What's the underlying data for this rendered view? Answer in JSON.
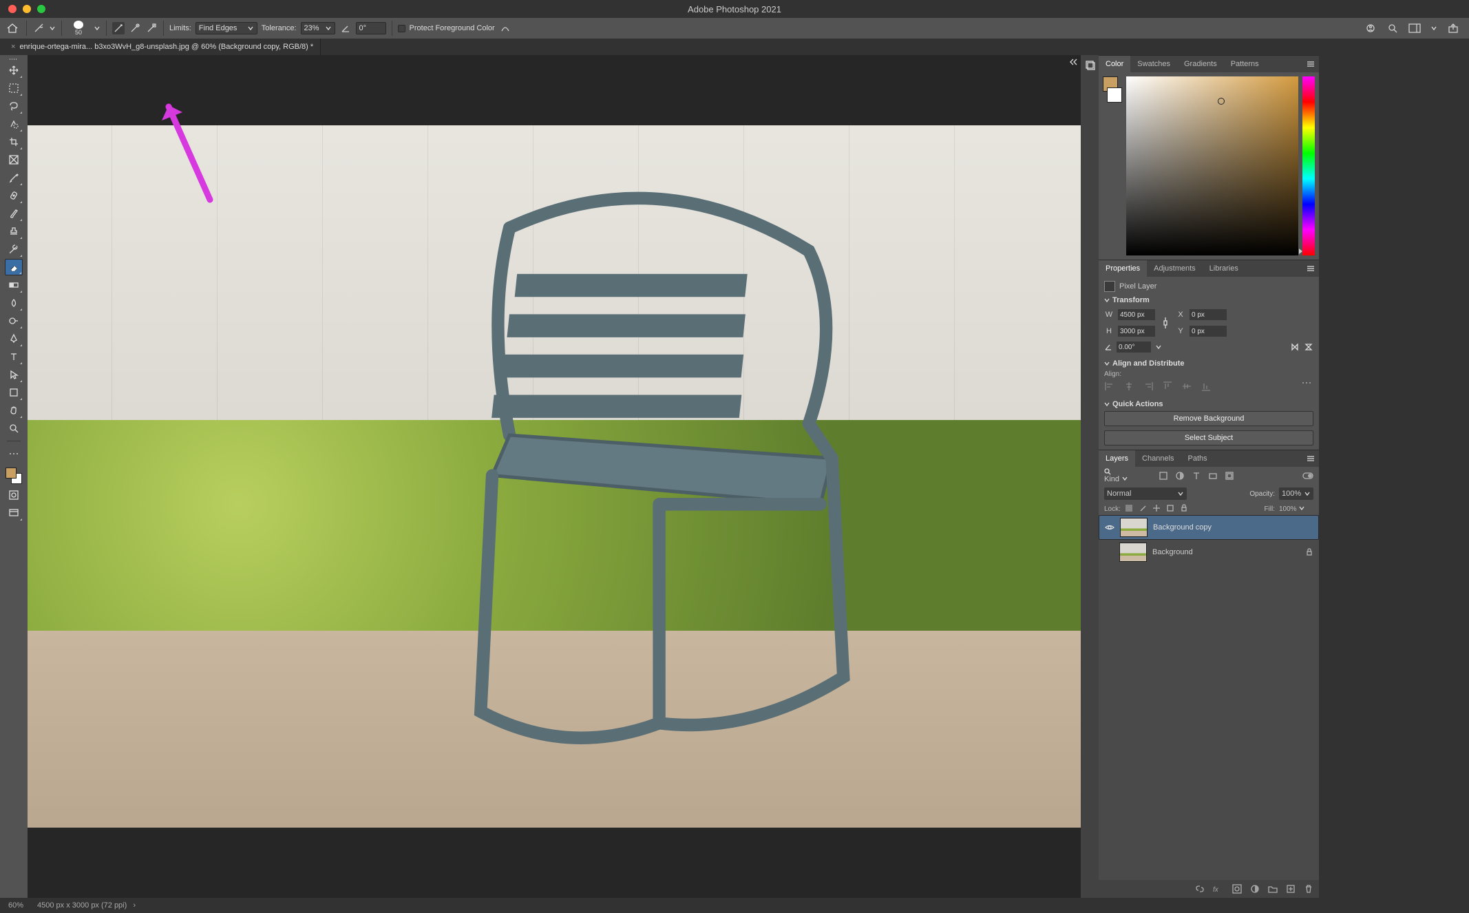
{
  "app_title": "Adobe Photoshop 2021",
  "optbar": {
    "brush_size": "50",
    "limits_label": "Limits:",
    "limits_value": "Find Edges",
    "tolerance_label": "Tolerance:",
    "tolerance_value": "23%",
    "angle_value": "0°",
    "protect_fg_label": "Protect Foreground Color"
  },
  "tab": {
    "filename": "enrique-ortega-mira...    b3xo3WvH_g8-unsplash.jpg @ 60% (Background copy, RGB/8) *"
  },
  "color_panel": {
    "tabs": [
      "Color",
      "Swatches",
      "Gradients",
      "Patterns"
    ],
    "fg_hex": "#c9a062"
  },
  "properties_panel": {
    "tabs": [
      "Properties",
      "Adjustments",
      "Libraries"
    ],
    "layer_type": "Pixel Layer",
    "transform_label": "Transform",
    "w": "4500 px",
    "h": "3000 px",
    "x": "0 px",
    "y": "0 px",
    "angle": "0.00°",
    "align_label": "Align and Distribute",
    "align_sub": "Align:",
    "quick_label": "Quick Actions",
    "remove_bg": "Remove Background",
    "select_subject": "Select Subject"
  },
  "layers_panel": {
    "tabs": [
      "Layers",
      "Channels",
      "Paths"
    ],
    "kind_label": "Kind",
    "blend_mode": "Normal",
    "opacity_label": "Opacity:",
    "opacity_value": "100%",
    "lock_label": "Lock:",
    "fill_label": "Fill:",
    "fill_value": "100%",
    "layers": [
      {
        "name": "Background copy",
        "visible": true,
        "selected": true,
        "locked": false
      },
      {
        "name": "Background",
        "visible": false,
        "selected": false,
        "locked": true
      }
    ]
  },
  "status": {
    "zoom": "60%",
    "doc_info": "4500 px x 3000 px (72 ppi)"
  }
}
